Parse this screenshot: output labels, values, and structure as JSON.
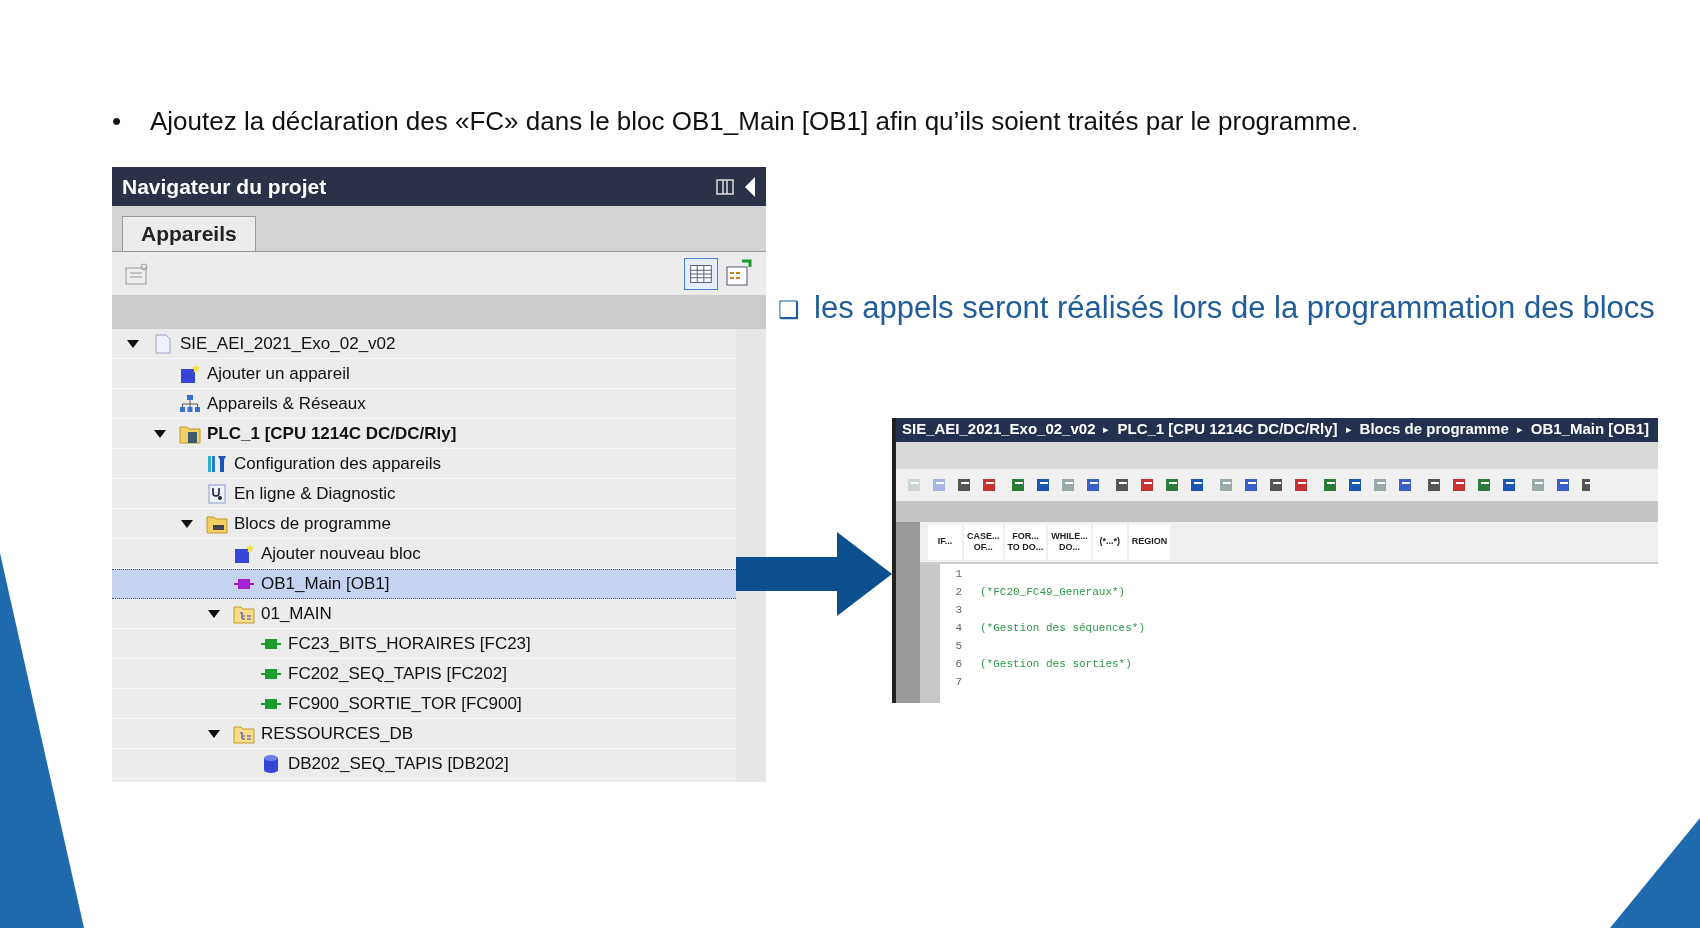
{
  "bullet": {
    "marker": "•",
    "text": "Ajoutez la déclaration des «FC» dans le bloc OB1_Main [OB1] afin qu’ils soient traités par le programme."
  },
  "navigator": {
    "title": "Navigateur du projet",
    "tabs": [
      {
        "label": "Appareils",
        "selected": true
      }
    ],
    "tree": [
      {
        "label": "SIE_AEI_2021_Exo_02_v02",
        "kind": "project",
        "expanded": true,
        "selected": false,
        "bold": false,
        "children": [
          {
            "label": "Ajouter un appareil",
            "kind": "add-device",
            "selected": false,
            "bold": false
          },
          {
            "label": "Appareils & Réseaux",
            "kind": "network",
            "selected": false,
            "bold": false
          },
          {
            "label": "PLC_1 [CPU 1214C DC/DC/Rly]",
            "kind": "plc",
            "expanded": true,
            "selected": false,
            "bold": true,
            "children": [
              {
                "label": "Configuration des appareils",
                "kind": "config",
                "selected": false,
                "bold": false
              },
              {
                "label": "En ligne & Diagnostic",
                "kind": "diagnostic",
                "selected": false,
                "bold": false
              },
              {
                "label": "Blocs de programme",
                "kind": "blocks-folder",
                "expanded": true,
                "selected": false,
                "bold": false,
                "children": [
                  {
                    "label": "Ajouter nouveau bloc",
                    "kind": "add-block",
                    "selected": false,
                    "bold": false
                  },
                  {
                    "label": "OB1_Main [OB1]",
                    "kind": "ob",
                    "selected": true,
                    "bold": false
                  },
                  {
                    "label": "01_MAIN",
                    "kind": "group",
                    "expanded": true,
                    "selected": false,
                    "bold": false,
                    "children": [
                      {
                        "label": "FC23_BITS_HORAIRES [FC23]",
                        "kind": "fc",
                        "selected": false,
                        "bold": false
                      },
                      {
                        "label": "FC202_SEQ_TAPIS [FC202]",
                        "kind": "fc",
                        "selected": false,
                        "bold": false
                      },
                      {
                        "label": "FC900_SORTIE_TOR [FC900]",
                        "kind": "fc",
                        "selected": false,
                        "bold": false
                      }
                    ]
                  },
                  {
                    "label": "RESSOURCES_DB",
                    "kind": "group",
                    "expanded": true,
                    "selected": false,
                    "bold": false,
                    "children": [
                      {
                        "label": "DB202_SEQ_TAPIS [DB202]",
                        "kind": "db",
                        "selected": false,
                        "bold": false
                      }
                    ]
                  }
                ]
              }
            ]
          }
        ]
      }
    ]
  },
  "note": {
    "marker": "❑",
    "text": "les appels seront réalisés lors de la programmation des blocs"
  },
  "editor": {
    "breadcrumb": [
      {
        "label": "SIE_AEI_2021_Exo_02_v02"
      },
      {
        "label": "PLC_1 [CPU 1214C DC/DC/Rly]"
      },
      {
        "label": "Blocs de programme"
      },
      {
        "label": "OB1_Main [OB1]"
      }
    ],
    "separator": "▸",
    "statements": [
      {
        "line1": "IF..."
      },
      {
        "line1": "CASE...",
        "line2": "OF..."
      },
      {
        "line1": "FOR...",
        "line2": "TO DO..."
      },
      {
        "line1": "WHILE...",
        "line2": "DO..."
      },
      {
        "line1": "(*...*)"
      },
      {
        "line1": "REGION"
      }
    ],
    "lines": [
      {
        "number": "1"
      },
      {
        "number": "2",
        "code": "(*FC20_FC49_Generaux*)"
      },
      {
        "number": "3"
      },
      {
        "number": "4",
        "code": "(*Gestion des séquences*)"
      },
      {
        "number": "5"
      },
      {
        "number": "6",
        "code": "(*Gestion des sorties*)"
      },
      {
        "number": "7"
      }
    ]
  }
}
